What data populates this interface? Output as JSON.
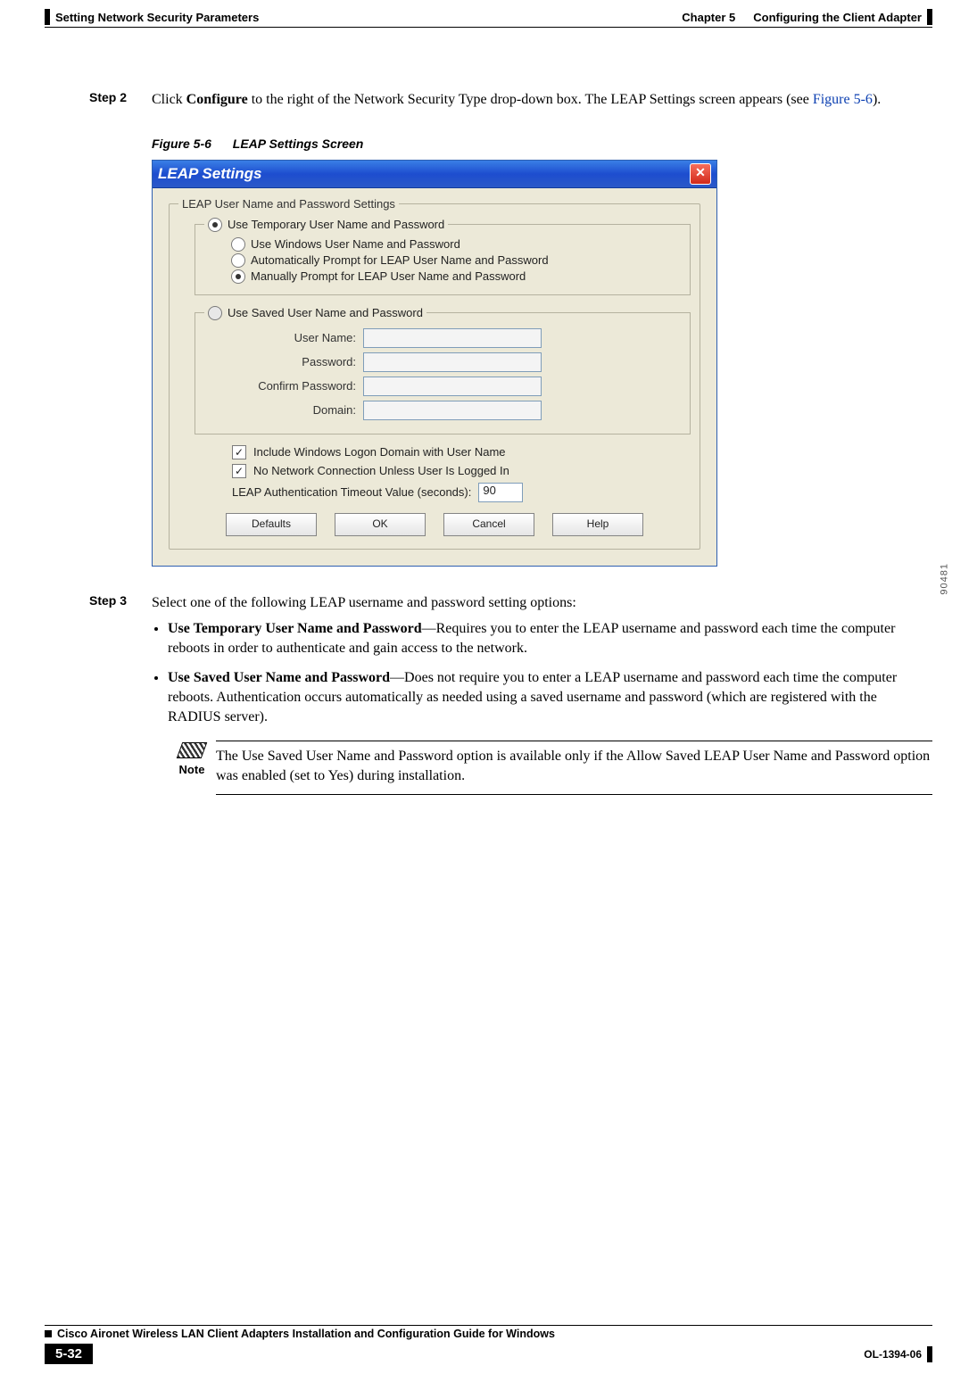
{
  "header": {
    "section_title": "Setting Network Security Parameters",
    "chapter_label": "Chapter 5",
    "chapter_title": "Configuring the Client Adapter"
  },
  "step2": {
    "label": "Step 2",
    "text_pre": "Click ",
    "text_bold": "Configure",
    "text_mid": " to the right of the Network Security Type drop-down box. The LEAP Settings screen appears (see ",
    "figref_link": "Figure 5-6",
    "text_post": ")."
  },
  "figure": {
    "ref": "Figure 5-6",
    "title": "LEAP Settings Screen"
  },
  "dialog": {
    "title": "LEAP Settings",
    "close": "✕",
    "group_legend": "LEAP User Name and Password Settings",
    "opt_temp": "Use Temporary User Name and Password",
    "sub_windows": "Use Windows User Name and Password",
    "sub_auto": "Automatically Prompt for LEAP User Name and Password",
    "sub_manual": "Manually Prompt for LEAP User Name and Password",
    "opt_saved": "Use Saved User Name and Password",
    "lbl_username": "User Name:",
    "lbl_password": "Password:",
    "lbl_confirm": "Confirm Password:",
    "lbl_domain": "Domain:",
    "chk_domain": "Include Windows Logon Domain with User Name",
    "chk_conn": "No Network Connection Unless User Is Logged In",
    "timeout_label": "LEAP Authentication Timeout Value (seconds):",
    "timeout_value": "90",
    "btn_defaults": "Defaults",
    "btn_ok": "OK",
    "btn_cancel": "Cancel",
    "btn_help": "Help",
    "image_id": "90481"
  },
  "step3": {
    "label": "Step 3",
    "intro": "Select one of the following LEAP username and password setting options:",
    "opt1_title": "Use Temporary User Name and Password",
    "opt1_body": "—Requires you to enter the LEAP username and password each time the computer reboots in order to authenticate and gain access to the network.",
    "opt2_title": "Use Saved User Name and Password",
    "opt2_body": "—Does not require you to enter a LEAP username and password each time the computer reboots. Authentication occurs automatically as needed using a saved username and password (which are registered with the RADIUS server).",
    "note_label": "Note",
    "note_body": "The Use Saved User Name and Password option is available only if the Allow Saved LEAP User Name and Password option was enabled (set to Yes) during installation."
  },
  "footer": {
    "book_title": "Cisco Aironet Wireless LAN Client Adapters Installation and Configuration Guide for Windows",
    "page_number": "5-32",
    "doc_id": "OL-1394-06"
  }
}
